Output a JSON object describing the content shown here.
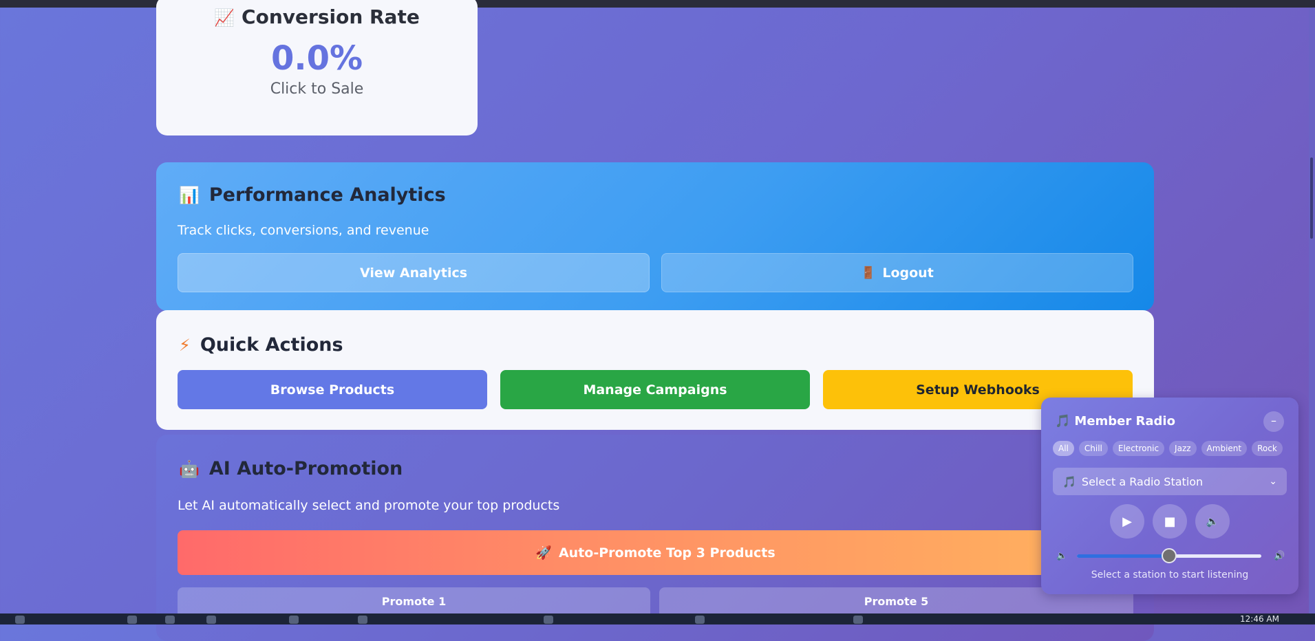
{
  "conversion": {
    "icon": "📈",
    "title": "Conversion Rate",
    "value": "0.0%",
    "subtitle": "Click to Sale"
  },
  "performance": {
    "icon": "📊",
    "title": "Performance Analytics",
    "description": "Track clicks, conversions, and revenue",
    "view_label": "View Analytics",
    "logout_icon": "🚪",
    "logout_label": "Logout"
  },
  "quick_actions": {
    "icon": "⚡",
    "title": "Quick Actions",
    "browse_label": "Browse Products",
    "campaigns_label": "Manage Campaigns",
    "webhooks_label": "Setup Webhooks"
  },
  "ai_promo": {
    "icon": "🤖",
    "title": "AI Auto-Promotion",
    "description": "Let AI automatically select and promote your top products",
    "auto_icon": "🚀",
    "auto_label": "Auto-Promote Top 3 Products",
    "promote1_label": "Promote 1",
    "promote5_label": "Promote 5"
  },
  "radio": {
    "icon": "🎵",
    "title": "Member Radio",
    "minimize": "–",
    "genres": [
      "All",
      "Chill",
      "Electronic",
      "Jazz",
      "Ambient",
      "Rock"
    ],
    "active_genre": "All",
    "select_icon": "🎵",
    "select_placeholder": "Select a Radio Station",
    "play": "▶",
    "stop": "■",
    "mute": "🔈",
    "vol_low": "🔈",
    "vol_high": "🔊",
    "volume": 0.5,
    "status": "Select a station to start listening"
  },
  "taskbar": {
    "clock": "12:46 AM"
  },
  "colors": {
    "accent": "#6573df",
    "green": "#29a645",
    "yellow": "#fdc109",
    "blue_btn": "#6378e6"
  }
}
